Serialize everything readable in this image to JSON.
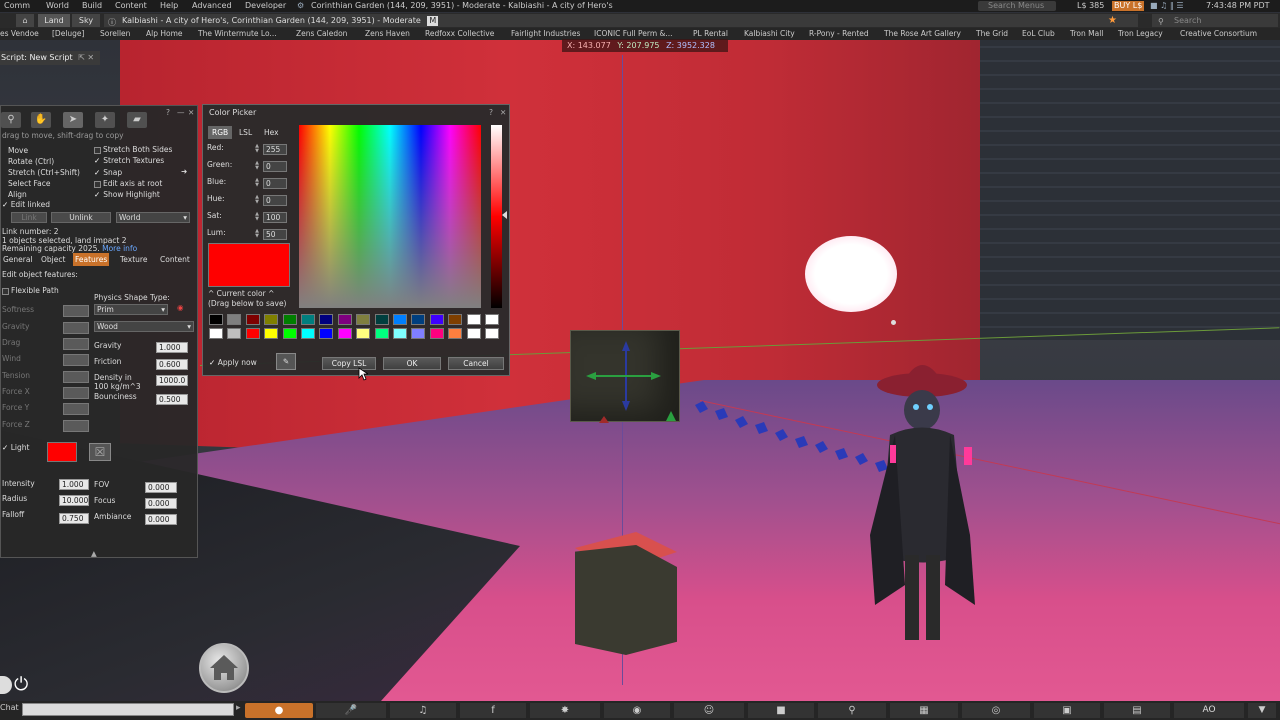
{
  "menubar": {
    "items": [
      "Comm",
      "World",
      "Build",
      "Content",
      "Help",
      "Advanced",
      "Developer"
    ],
    "location_title": "Corinthian Garden (144, 209, 3951) - Moderate - Kalbiashi - A city of Hero's",
    "search_placeholder": "Search Menus",
    "balance": "L$ 385",
    "buy_label": "BUY L$",
    "time": "7:43:48 PM PDT"
  },
  "locbar": {
    "land_label": "Land",
    "sky_label": "Sky",
    "address": "Kalbiashi - A city of Hero's, Corinthian Garden (144, 209, 3951) - Moderate",
    "rating_badge": "M",
    "search_placeholder": "Search"
  },
  "favorites": [
    "es Vendoe",
    "[Deluge]",
    "Sorellen",
    "Alp Home",
    "The Wintermute Lo...",
    "Zens Caledon",
    "Zens Haven",
    "Redfoxx Collective",
    "Fairlight Industries",
    "ICONIC Full Perm &...",
    "PL Rental",
    "Kalbiashi City",
    "R-Pony - Rented",
    "The Rose Art Gallery",
    "The Grid",
    "EoL Club",
    "Tron Mall",
    "Tron Legacy",
    "Creative Consortium"
  ],
  "coords": {
    "x": "X: 143.077",
    "y": "Y: 207.975",
    "z": "Z: 3952.328"
  },
  "script_tab": {
    "label": "Script: New Script"
  },
  "build": {
    "hint": "drag to move, shift-drag to copy",
    "modes": [
      "Move",
      "Rotate (Ctrl)",
      "Stretch (Ctrl+Shift)",
      "Select Face",
      "Align"
    ],
    "edit_linked": "Edit linked",
    "options": [
      "Stretch Both Sides",
      "Stretch Textures",
      "Snap",
      "Edit axis at root",
      "Show Highlight"
    ],
    "link_label": "Link",
    "unlink_label": "Unlink",
    "ruler": "World",
    "link_number": "Link number: 2",
    "selected": "1 objects selected, land impact 2",
    "capacity": "Remaining capacity 2025.",
    "more_info": "More info",
    "tabs": [
      "General",
      "Object",
      "Features",
      "Texture",
      "Content"
    ],
    "active_tab": "Features",
    "edit_features": "Edit object features:",
    "flexible_path": "Flexible Path",
    "flex_fields": [
      "Softness",
      "Gravity",
      "Drag",
      "Wind",
      "Tension",
      "Force X",
      "Force Y",
      "Force Z"
    ],
    "physics_shape_label": "Physics Shape Type:",
    "physics_shape": "Prim",
    "material": "Wood",
    "gravity_label": "Gravity",
    "gravity": "1.000",
    "friction_label": "Friction",
    "friction": "0.600",
    "density_label": "Density in 100 kg/m^3",
    "density": "1000.0",
    "bounciness_label": "Bounciness",
    "bounciness": "0.500",
    "light_label": "Light",
    "light_color": "#ff0000",
    "intensity_label": "Intensity",
    "intensity": "1.000",
    "radius_label": "Radius",
    "radius": "10.000",
    "falloff_label": "Falloff",
    "falloff": "0.750",
    "fov_label": "FOV",
    "fov": "0.000",
    "focus_label": "Focus",
    "focus": "0.000",
    "ambiance_label": "Ambiance",
    "ambiance": "0.000"
  },
  "color_picker": {
    "title": "Color Picker",
    "tabs": [
      "RGB",
      "LSL",
      "Hex"
    ],
    "red_label": "Red:",
    "red": "255",
    "green_label": "Green:",
    "green": "0",
    "blue_label": "Blue:",
    "blue": "0",
    "hue_label": "Hue:",
    "hue": "0",
    "sat_label": "Sat:",
    "sat": "100",
    "lum_label": "Lum:",
    "lum": "50",
    "current_label": "^ Current color ^",
    "drag_hint": "(Drag below to save)",
    "current_color": "#ff0000",
    "apply_now": "Apply now",
    "copy_lsl": "Copy LSL",
    "ok": "OK",
    "cancel": "Cancel",
    "palette_row1": [
      "#000000",
      "#7f7f7f",
      "#7f0000",
      "#7f7f00",
      "#007f00",
      "#007f7f",
      "#00007f",
      "#7f007f",
      "#7f7f3f",
      "#003f3f",
      "#007fff",
      "#003f7f",
      "#3f00ff",
      "#7f3f00",
      "#ffffff",
      "#ffffff"
    ],
    "palette_row2": [
      "#ffffff",
      "#bfbfbf",
      "#ff0000",
      "#ffff00",
      "#00ff00",
      "#00ffff",
      "#0000ff",
      "#ff00ff",
      "#ffff7f",
      "#00ff7f",
      "#7fffff",
      "#7f7fff",
      "#ff007f",
      "#ff7f3f",
      "#ffffff",
      "#ffffff"
    ]
  },
  "bottom": {
    "chat_label": "Chat",
    "ao_label": "AO"
  }
}
